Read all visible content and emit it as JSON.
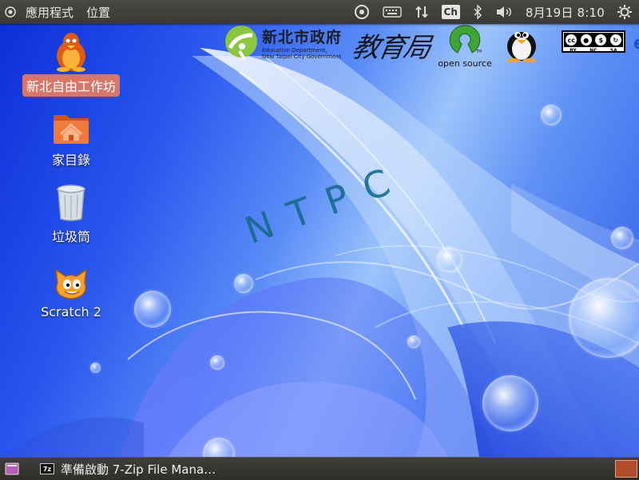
{
  "top_panel": {
    "menu_apps": "應用程式",
    "menu_places": "位置",
    "input_method": "Ch",
    "clock": "8月19日 8:10",
    "icons": [
      "ubuntu-logo-icon",
      "keyboard-icon",
      "network-arrows-icon",
      "input-method-icon",
      "bluetooth-icon",
      "volume-icon",
      "gear-icon"
    ]
  },
  "desktop": {
    "icons": [
      {
        "label": "新北自由工作坊",
        "icon": "tux-icon",
        "selected": true
      },
      {
        "label": "家目錄",
        "icon": "home-folder-icon"
      },
      {
        "label": "垃圾筒",
        "icon": "trash-icon"
      },
      {
        "label": "Scratch 2",
        "icon": "scratch-cat-icon"
      }
    ],
    "wallpaper_text": "NTPC",
    "header": {
      "ntpc_cn": "新北市政府",
      "ntpc_en1": "Education Department,",
      "ntpc_en2": "New Taipei City Government",
      "edu_bureau": "教育局",
      "osi_text": "open source",
      "osi_tm": "TM",
      "cc_tags": [
        "BY",
        "NC",
        "SA"
      ],
      "cc_mark": "cc",
      "edge_letter": "e"
    }
  },
  "bottom_panel": {
    "task_zip_badge": "7z",
    "task_label": "準備啟動 7-Zip File Mana…"
  },
  "colors": {
    "panel": "#3c3b37",
    "selected_label": "#d8766a",
    "workspace": "#b04d2a",
    "ntpc_text": "#156b8d"
  }
}
